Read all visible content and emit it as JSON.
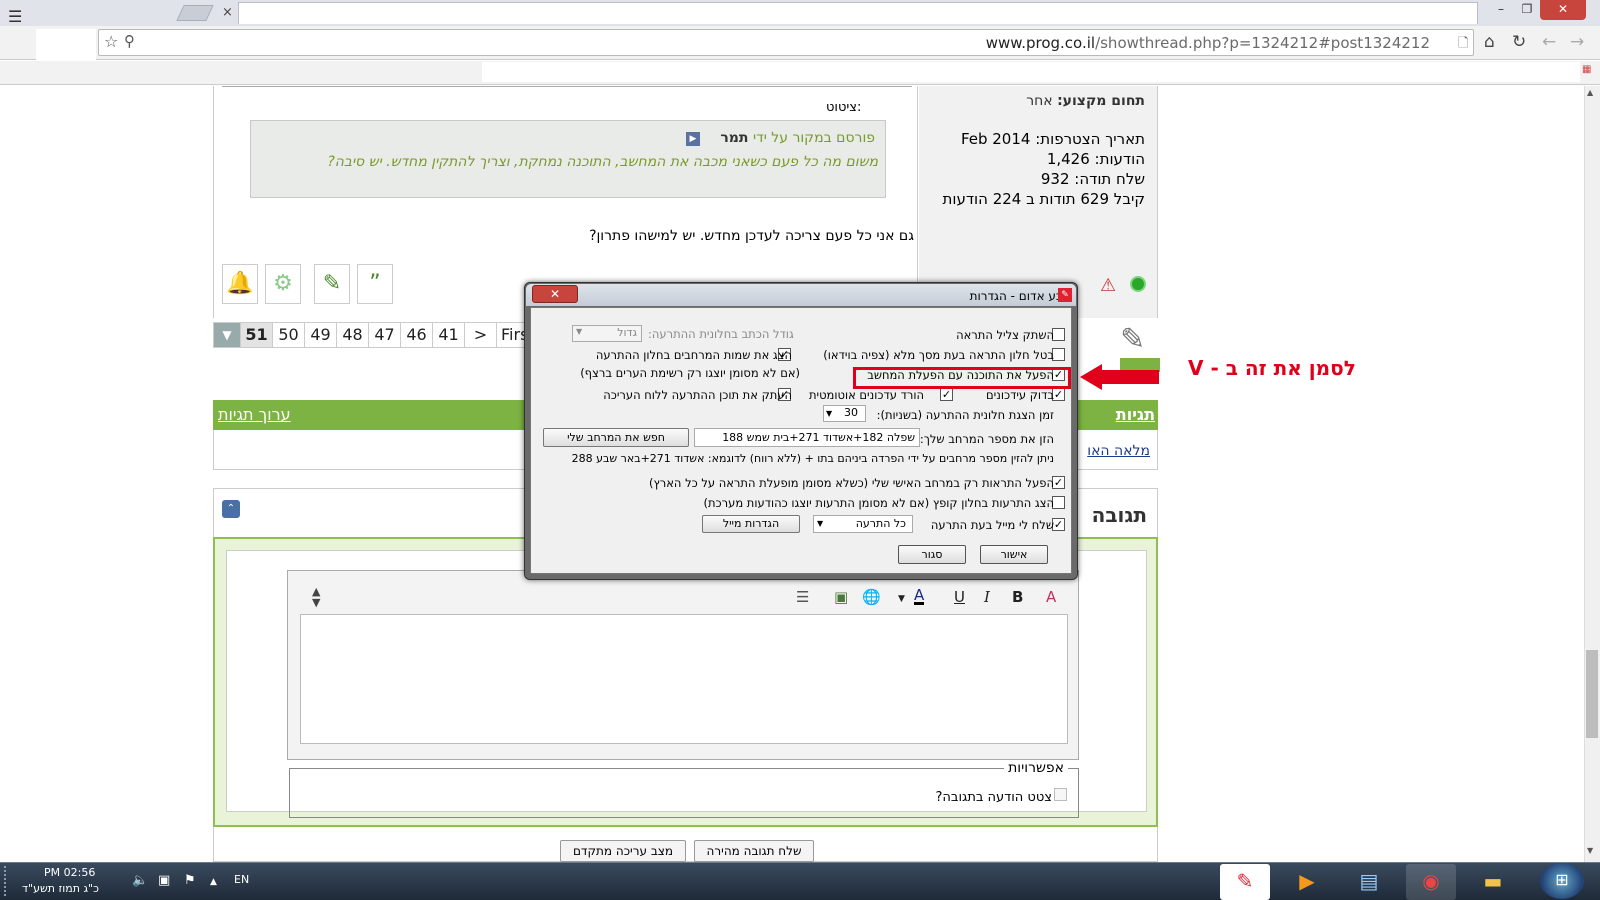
{
  "browser": {
    "url_domain": "www.prog.co.il",
    "url_path": "/showthread.php?p=1324212#post1324212",
    "tab_close": "×",
    "window_min": "–",
    "window_max": "❐",
    "window_close": "✕"
  },
  "post": {
    "quote_label": "ציטוט:",
    "quote_posted_prefix": "פורסם במקור על ידי",
    "quote_author": "תמר",
    "quote_text": "משום מה כל פעם כשאני מכבה את המחשב, התוכנה נמחקת, וצריך להתקין מחדש. יש סיבה?",
    "text": "גם אני כל פעם צריכה לעדכן מחדש. יש למישהו פתרון?"
  },
  "userinfo": {
    "field_label": "תחום מקצוע:",
    "field_value": "אחר",
    "join_date": "תאריך הצטרפות: Feb 2014",
    "posts": "הודעות: 1,426",
    "thanks_sent": "שלח תודה: 932",
    "thanks_received": "קיבל 629 תודות ב 224 הודעות"
  },
  "pager": {
    "pages": [
      "51",
      "50",
      "49",
      "48",
      "47",
      "46",
      "41",
      ">",
      "First"
    ],
    "current": "51"
  },
  "tags": {
    "title": "תגיות",
    "edit": "ערוך תגיות",
    "item": "מלאה האו"
  },
  "reply": {
    "title": "תגובה",
    "options_legend": "אפשרויות",
    "signature_label": "צטט הודעה בתגובה?",
    "quick_reply": "שלח תגובה מהירה",
    "advanced": "מצב עריכה מתקדם"
  },
  "editor": {
    "bold": "B",
    "italic": "I",
    "underline": "U",
    "color": "A",
    "clear": "A"
  },
  "dialog": {
    "title": "צבע אדום - הגדרות",
    "close": "✕",
    "mute_label": "השתק צליל התראה",
    "fullscreen_label": "בטל חלון התראה בעת מסך מלא (צפיה בוידאו)",
    "autostart_label": "הפעל את התוכנה עם הפעלת המחשב",
    "updates_label": "בדוק עידכונים",
    "auto_download_label": "הורד עדכונים אוטומטית",
    "duration_label": "זמן הצגת חלונית ההתרעה (בשניות):",
    "duration_value": "30",
    "fontsize_label": "גודל הכתב בחלונית ההתרעה:",
    "fontsize_value": "גדול",
    "show_regions_label": "הצג את שמות המרחבים בחלון ההתרעה",
    "show_regions_note": "(אם לא מסומן יוצגו רק רשימת הערים ברצף)",
    "copy_label": "העתק את תוכן ההתרעה ללוח העריכה",
    "regions_label": "הזן את מספר המרחב שלך:",
    "regions_value": "שפלה 182+אשדוד 271+בית שמש 188",
    "find_button": "חפש את המרחב שלי",
    "regions_hint": "ניתן להזין מספר מרחבים על ידי הפרדה ביניהם בתו + (ללא רווח) לדוגמא: אשדוד 271+באר שבע 288",
    "only_my_region_label": "הפעל התראות רק במרחב האישי שלי  (כשלא מסומן מופעלת התראה על כל הארץ)",
    "popup_label": "הצג התרעות בחלון קופץ (אם לא מסומן התרעות יוצגו כהודעות מערכת)",
    "mail_label": "שלח לי מייל בעת התרעה",
    "mail_option": "כל התרעה",
    "mail_settings": "הגדרות מייל",
    "ok": "אישור",
    "close_btn": "סגור",
    "check": "✓"
  },
  "annotation": {
    "text": "לסמן את זה ב - V"
  },
  "taskbar": {
    "time": "PM 02:56",
    "date": "כ\"ג תמוז תשע\"ד",
    "lang": "EN"
  }
}
